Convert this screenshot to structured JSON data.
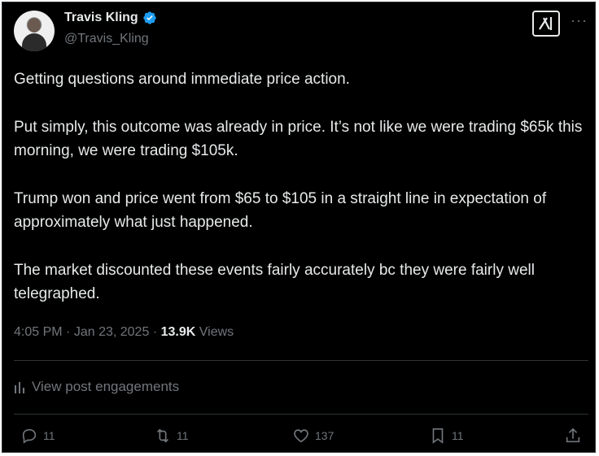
{
  "author": {
    "name": "Travis Kling",
    "handle": "@Travis_Kling"
  },
  "post": {
    "paragraphs": [
      "Getting questions around immediate price action.",
      "Put simply, this outcome was already in price. It’s not like we were trading $65k this morning, we were trading $105k.",
      "Trump won and price went from $65 to $105 in a straight line in expectation of approximately what just happened.",
      "The market discounted these events fairly accurately bc they were fairly well telegraphed."
    ],
    "time": "4:05 PM",
    "date": "Jan 23, 2025",
    "views_count": "13.9K",
    "views_label": "Views"
  },
  "engagements_label": "View post engagements",
  "actions": {
    "replies": "11",
    "reposts": "11",
    "likes": "137",
    "bookmarks": "11"
  },
  "icons": [
    "verified-badge-icon",
    "grok-icon",
    "more-icon",
    "analytics-icon",
    "reply-icon",
    "repost-icon",
    "like-icon",
    "bookmark-icon",
    "share-icon"
  ],
  "colors": {
    "background": "#000000",
    "text": "#e7e9ea",
    "muted": "#71767b",
    "verified": "#1d9bf0",
    "divider": "#2f3336"
  }
}
